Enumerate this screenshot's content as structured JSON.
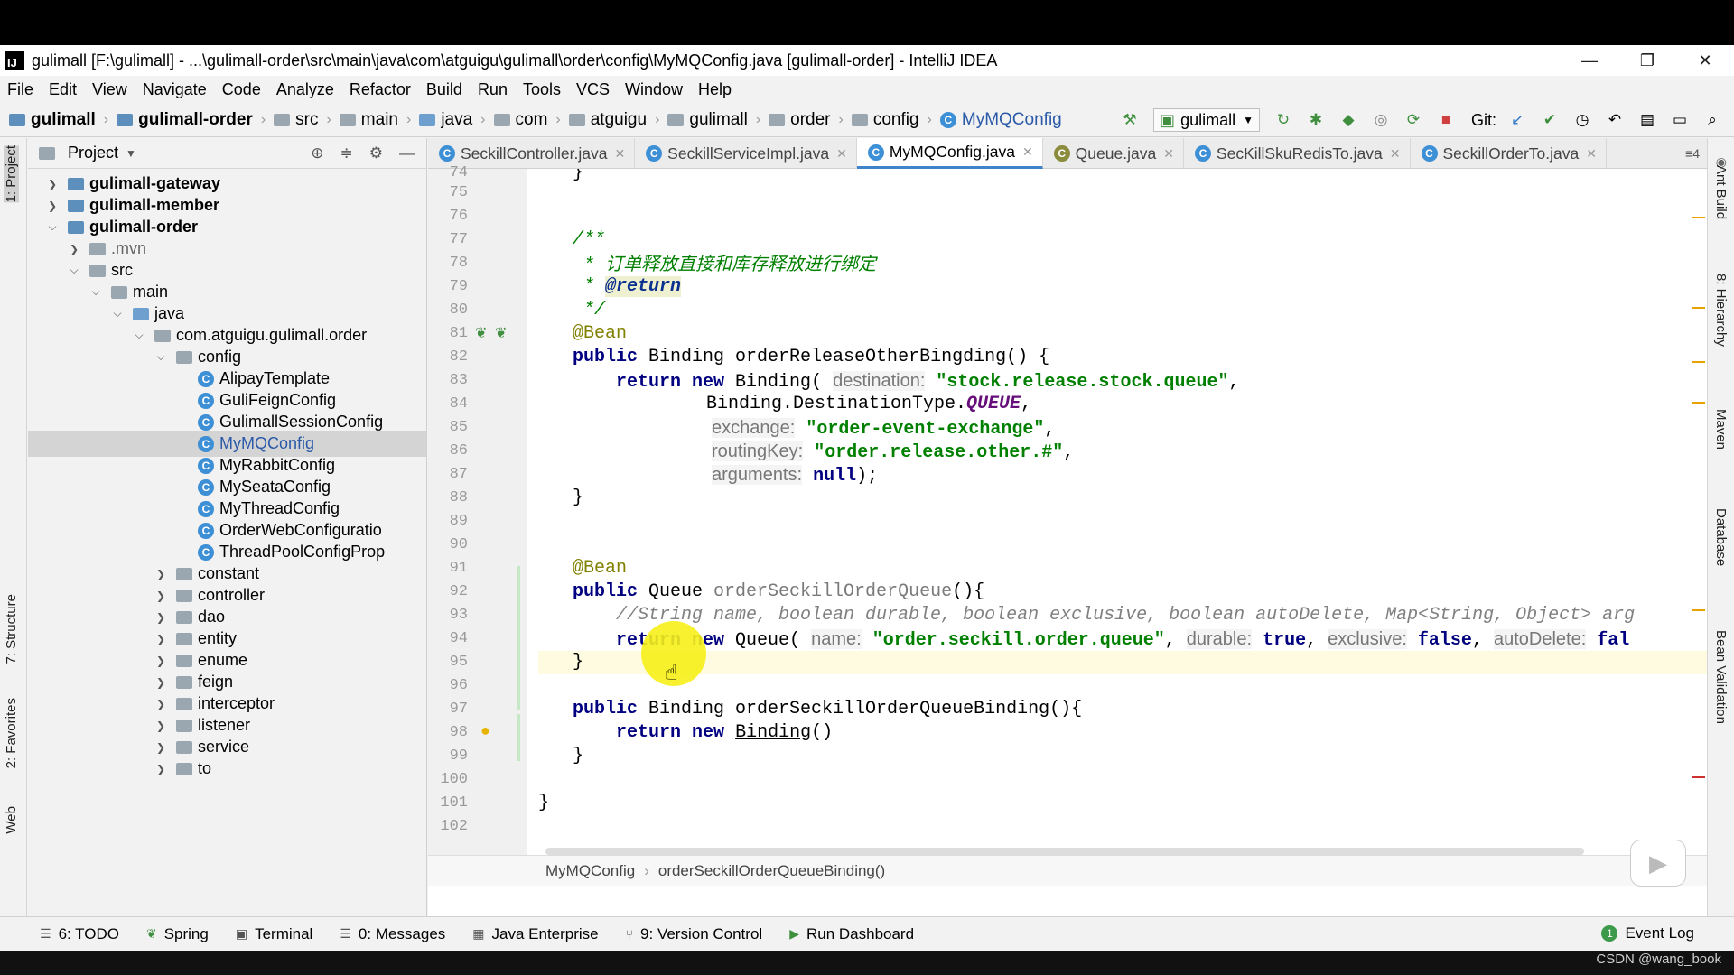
{
  "window": {
    "title": "gulimall [F:\\gulimall] - ...\\gulimall-order\\src\\main\\java\\com\\atguigu\\gulimall\\order\\config\\MyMQConfig.java [gulimall-order] - IntelliJ IDEA",
    "minimize": "—",
    "restore": "❐",
    "close": "✕"
  },
  "menu": [
    "File",
    "Edit",
    "View",
    "Navigate",
    "Code",
    "Analyze",
    "Refactor",
    "Build",
    "Run",
    "Tools",
    "VCS",
    "Window",
    "Help"
  ],
  "nav": {
    "crumbs": [
      "gulimall",
      "gulimall-order",
      "src",
      "main",
      "java",
      "com",
      "atguigu",
      "gulimall",
      "order",
      "config",
      "MyMQConfig"
    ],
    "run_config": "gulimall",
    "git_label": "Git:"
  },
  "left_stripe": {
    "project": "1: Project",
    "structure": "7: Structure",
    "favorites": "2: Favorites",
    "web": "Web"
  },
  "project_panel": {
    "title": "Project",
    "tree": [
      {
        "label": "gulimall-gateway",
        "bold": true
      },
      {
        "label": "gulimall-member",
        "bold": true
      },
      {
        "label": "gulimall-order",
        "bold": true
      },
      {
        "label": ".mvn"
      },
      {
        "label": "src"
      },
      {
        "label": "main"
      },
      {
        "label": "java"
      },
      {
        "label": "com.atguigu.gulimall.order"
      },
      {
        "label": "config"
      },
      {
        "label": "AlipayTemplate"
      },
      {
        "label": "GuliFeignConfig"
      },
      {
        "label": "GulimallSessionConfig"
      },
      {
        "label": "MyMQConfig"
      },
      {
        "label": "MyRabbitConfig"
      },
      {
        "label": "MySeataConfig"
      },
      {
        "label": "MyThreadConfig"
      },
      {
        "label": "OrderWebConfiguratio"
      },
      {
        "label": "ThreadPoolConfigProp"
      },
      {
        "label": "constant"
      },
      {
        "label": "controller"
      },
      {
        "label": "dao"
      },
      {
        "label": "entity"
      },
      {
        "label": "enume"
      },
      {
        "label": "feign"
      },
      {
        "label": "interceptor"
      },
      {
        "label": "listener"
      },
      {
        "label": "service"
      },
      {
        "label": "to"
      }
    ]
  },
  "tabs": [
    "SeckillController.java",
    "SeckillServiceImpl.java",
    "MyMQConfig.java",
    "Queue.java",
    "SecKillSkuRedisTo.java",
    "SeckillOrderTo.java"
  ],
  "tab_overflow": "4",
  "line_numbers": [
    "74",
    "75",
    "76",
    "77",
    "78",
    "79",
    "80",
    "81",
    "82",
    "83",
    "84",
    "85",
    "86",
    "87",
    "88",
    "89",
    "90",
    "91",
    "92",
    "93",
    "94",
    "95",
    "96",
    "97",
    "98",
    "99",
    "100",
    "101",
    "102"
  ],
  "code": {
    "l74": "}",
    "l77": "/**",
    "l78_star": " * ",
    "l78_text": "订单释放直接和库存释放进行绑定",
    "l79_star": " * ",
    "l79_tag": "@return",
    "l80": " */",
    "l81": "@Bean",
    "l82_kw": "public",
    "l82_rest": " Binding orderReleaseOtherBingding() {",
    "l83_kw1": "return",
    "l83_kw2": "new",
    "l83_cls": " Binding(",
    "l83_hint": "destination:",
    "l83_str": "\"stock.release.stock.queue\"",
    "l84_pre": "Binding.DestinationType.",
    "l84_const": "QUEUE",
    "l85_hint": "exchange:",
    "l85_str": "\"order-event-exchange\"",
    "l86_hint": "routingKey:",
    "l86_str": "\"order.release.other.#\"",
    "l87_hint": "arguments:",
    "l87_kw": "null",
    "l87_end": ");",
    "l88": "}",
    "l91": "@Bean",
    "l92_kw": "public",
    "l92_type": " Queue ",
    "l92_meth": "orderSeckillOrderQueue",
    "l92_end": "(){",
    "l93": "//String name, boolean durable, boolean exclusive, boolean autoDelete, Map<String, Object> arg",
    "l94_kw1": "return",
    "l94_kw2": "new",
    "l94_cls": " Queue(",
    "l94_h1": "name:",
    "l94_s1": "\"order.seckill.order.queue\"",
    "l94_h2": "durable:",
    "l94_v2": "true",
    "l94_h3": "exclusive:",
    "l94_v3": "false",
    "l94_h4": "autoDelete:",
    "l94_v4": "fal",
    "l95": "}",
    "l97_kw": "public",
    "l97_rest": " Binding orderSeckillOrderQueueBinding(){",
    "l98_kw1": "return",
    "l98_kw2": "new",
    "l98_cls": "Binding",
    "l98_end": "()",
    "l99": "}",
    "l101": "}"
  },
  "editor_breadcrumb": [
    "MyMQConfig",
    "orderSeckillOrderQueueBinding()"
  ],
  "right_stripe": [
    "Ant Build",
    "8: Hierarchy",
    "Maven",
    "Database",
    "Bean Validation"
  ],
  "statusbar": {
    "items": [
      "6: TODO",
      "Spring",
      "Terminal",
      "0: Messages",
      "Java Enterprise",
      "9: Version Control",
      "Run Dashboard"
    ],
    "event_log": "Event Log"
  },
  "watermark": "CSDN @wang_book"
}
